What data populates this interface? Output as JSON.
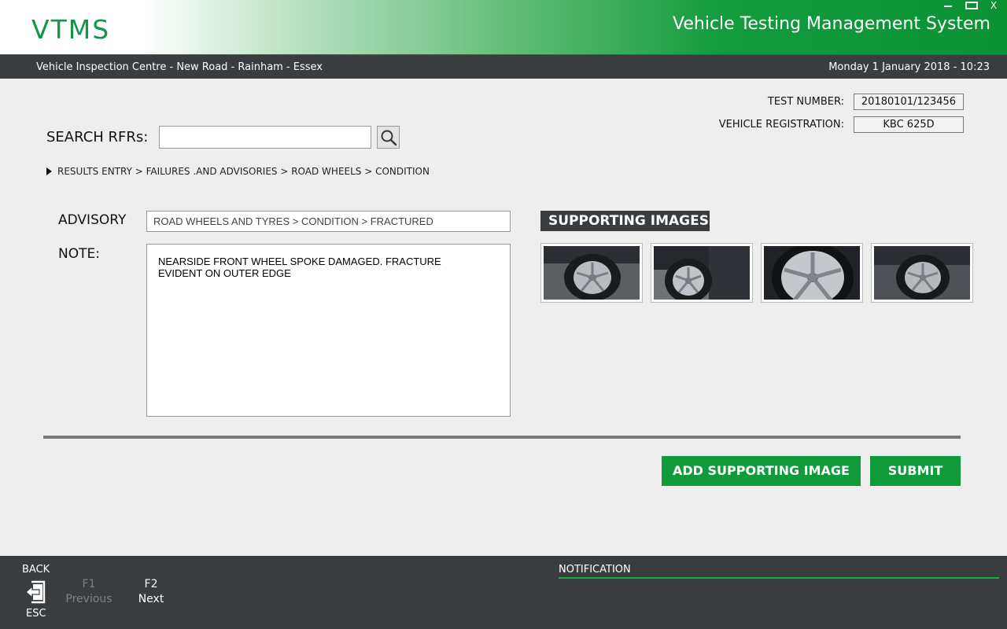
{
  "header": {
    "logo": "VTMS",
    "title": "Vehicle Testing Management System",
    "window_close": "X"
  },
  "subbar": {
    "location": "Vehicle Inspection Centre - New Road - Rainham - Essex",
    "datetime": "Monday 1 January 2018 - 10:23"
  },
  "test_info": {
    "test_number_label": "TEST NUMBER:",
    "test_number": "20180101/123456",
    "vehicle_registration_label": "VEHICLE REGISTRATION:",
    "vehicle_registration": "KBC 625D"
  },
  "search": {
    "label": "SEARCH RFRs:",
    "value": "",
    "icon": "search-icon"
  },
  "breadcrumb": "RESULTS ENTRY > FAILURES .AND ADVISORIES > ROAD WHEELS > CONDITION",
  "form": {
    "advisory_label": "ADVISORY",
    "advisory_value": "ROAD WHEELS AND TYRES > CONDITION > FRACTURED",
    "note_label": "NOTE:",
    "note_value": "NEARSIDE FRONT WHEEL SPOKE DAMAGED. FRACTURE\nEVIDENT ON OUTER EDGE"
  },
  "supporting_images": {
    "heading": "SUPPORTING IMAGES",
    "count": 4
  },
  "actions": {
    "add_image": "ADD SUPPORTING IMAGE",
    "submit": "SUBMIT"
  },
  "footer": {
    "back_label": "BACK",
    "esc_label": "ESC",
    "f1_key": "F1",
    "f1_label": "Previous",
    "f2_key": "F2",
    "f2_label": "Next",
    "notification_label": "NOTIFICATION"
  },
  "colors": {
    "brand_green": "#119a3c",
    "dark_bar": "#3a3d40",
    "background": "#eeeeee"
  }
}
